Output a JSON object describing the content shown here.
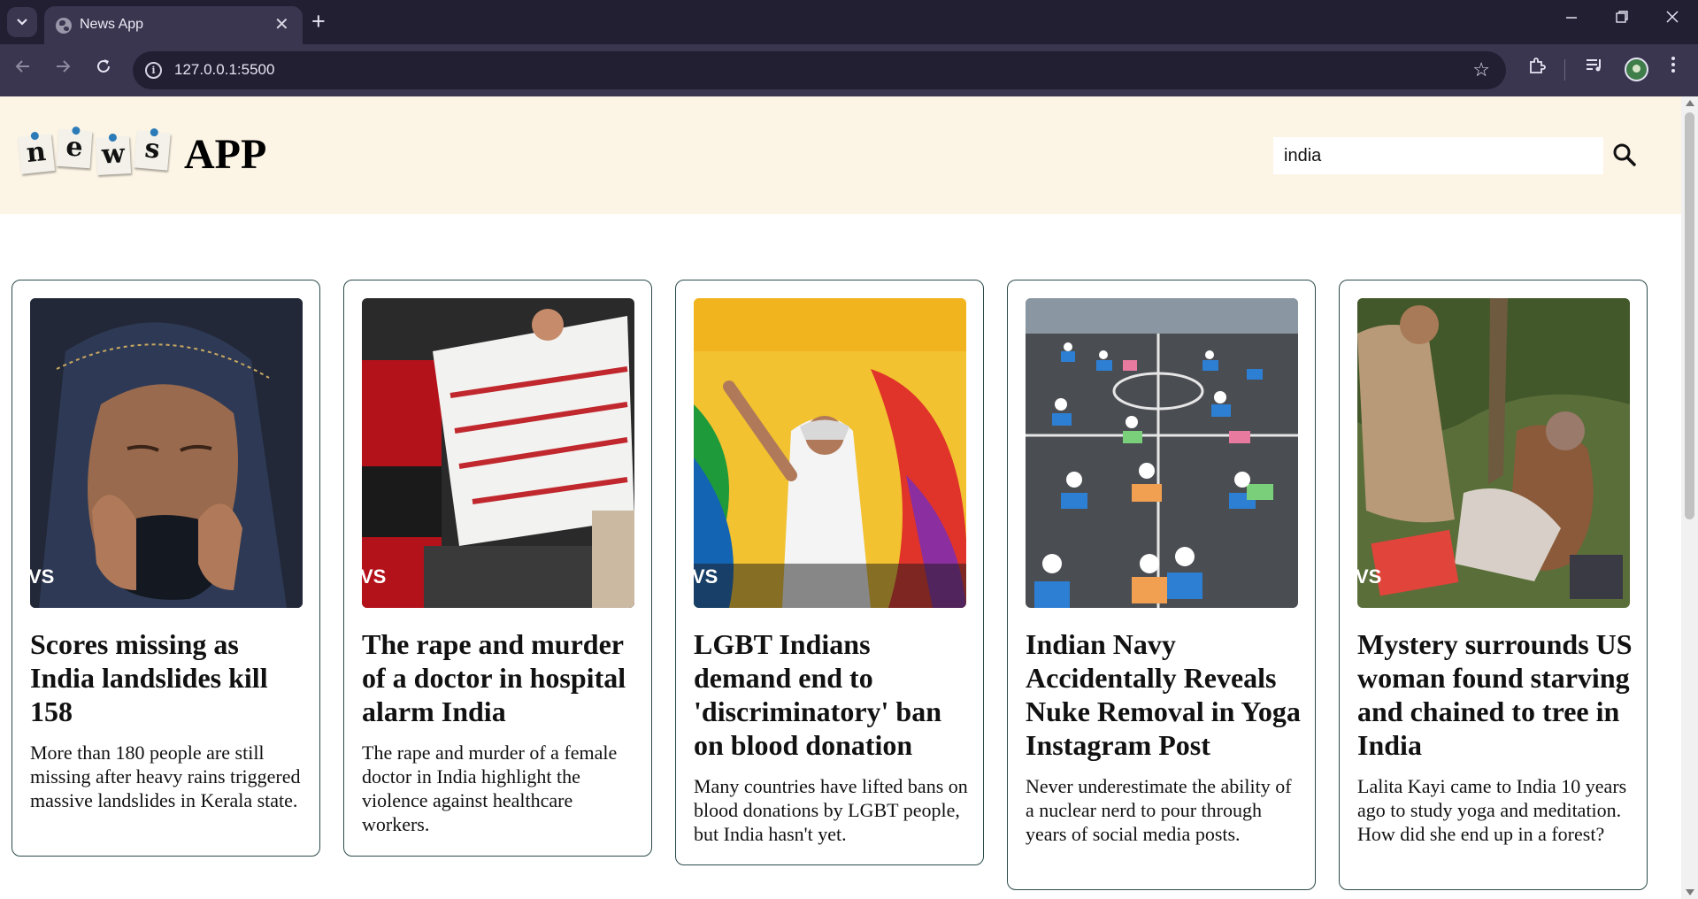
{
  "browser": {
    "tab_title": "News App",
    "url": "127.0.0.1:5500"
  },
  "header": {
    "logo_letters": [
      "n",
      "e",
      "w",
      "s"
    ],
    "app_title": "APP",
    "search_value": "india"
  },
  "colors": {
    "header_bg": "#fcf4e5",
    "card_border": "#2c4a4a",
    "chrome_dark": "#221f33",
    "chrome_mid": "#3a3650"
  },
  "cards": [
    {
      "image_overlay": "VS",
      "title": "Scores missing as India landslides kill 158",
      "description": "More than 180 people are still missing after heavy rains triggered massive landslides in Kerala state."
    },
    {
      "image_overlay": "VS",
      "title": "The rape and murder of a doctor in hospital alarm India",
      "description": "The rape and murder of a female doctor in India highlight the violence against healthcare workers."
    },
    {
      "image_overlay": "VS",
      "title": "LGBT Indians demand end to 'discriminatory' ban on blood donation",
      "description": "Many countries have lifted bans on blood donations by LGBT people, but India hasn't yet."
    },
    {
      "image_overlay": "",
      "title": "Indian Navy Accidentally Reveals Nuke Removal in Yoga Instagram Post",
      "description": "Never underestimate the ability of a nuclear nerd to pour through years of social media posts."
    },
    {
      "image_overlay": "VS",
      "title": "Mystery surrounds US woman found starving and chained to tree in India",
      "description": "Lalita Kayi came to India 10 years ago to study yoga and meditation. How did she end up in a forest?"
    }
  ]
}
